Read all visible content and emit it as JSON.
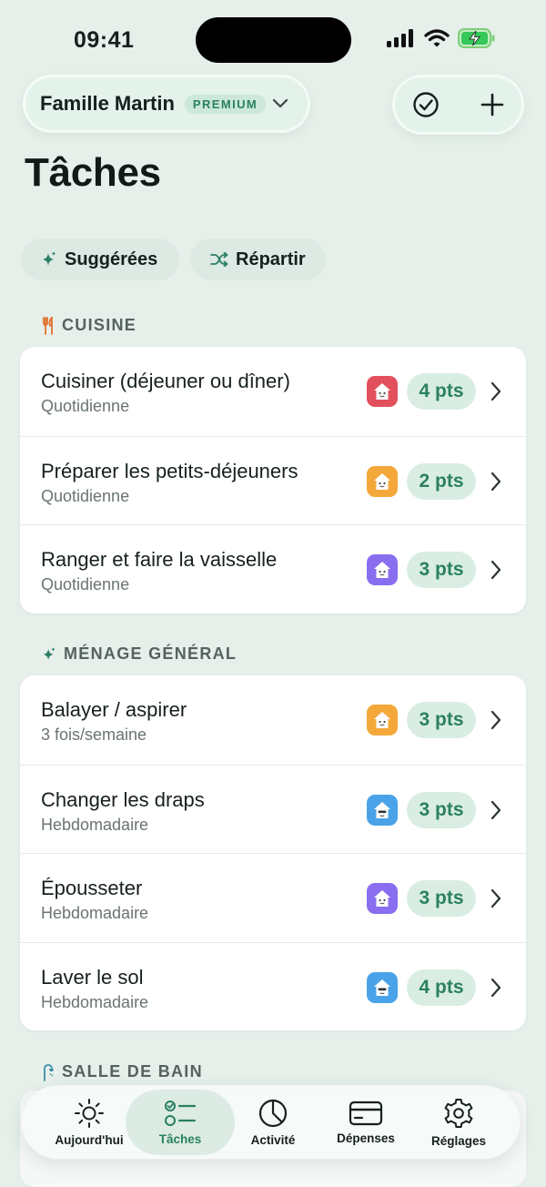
{
  "status": {
    "time": "09:41"
  },
  "header": {
    "household": "Famille Martin",
    "badge": "PREMIUM",
    "title": "Tâches"
  },
  "chips": [
    {
      "label": "Suggérées",
      "icon": "sparkle-icon"
    },
    {
      "label": "Répartir",
      "icon": "shuffle-icon"
    }
  ],
  "sections": [
    {
      "title": "CUISINE",
      "icon": "fork-knife-icon",
      "tasks": [
        {
          "name": "Cuisiner (déjeuner ou dîner)",
          "frequency": "Quotidienne",
          "points": "4 pts",
          "avatar_color": "#e2505e"
        },
        {
          "name": "Préparer les petits-déjeuners",
          "frequency": "Quotidienne",
          "points": "2 pts",
          "avatar_color": "#f4a83a"
        },
        {
          "name": "Ranger et faire la vaisselle",
          "frequency": "Quotidienne",
          "points": "3 pts",
          "avatar_color": "#8a6ef0"
        }
      ]
    },
    {
      "title": "MÉNAGE GÉNÉRAL",
      "icon": "sparkle-icon",
      "tasks": [
        {
          "name": "Balayer / aspirer",
          "frequency": "3 fois/semaine",
          "points": "3 pts",
          "avatar_color": "#f4a83a"
        },
        {
          "name": "Changer les draps",
          "frequency": "Hebdomadaire",
          "points": "3 pts",
          "avatar_color": "#4aa3e8"
        },
        {
          "name": "Épousseter",
          "frequency": "Hebdomadaire",
          "points": "3 pts",
          "avatar_color": "#8a6ef0"
        },
        {
          "name": "Laver le sol",
          "frequency": "Hebdomadaire",
          "points": "4 pts",
          "avatar_color": "#4aa3e8"
        }
      ]
    },
    {
      "title": "SALLE DE BAIN",
      "icon": "shower-icon",
      "tasks": []
    }
  ],
  "tabs": [
    {
      "label": "Aujourd'hui",
      "icon": "sun-icon",
      "active": false
    },
    {
      "label": "Tâches",
      "icon": "checklist-icon",
      "active": true
    },
    {
      "label": "Activité",
      "icon": "pie-chart-icon",
      "active": false
    },
    {
      "label": "Dépenses",
      "icon": "credit-card-icon",
      "active": false
    },
    {
      "label": "Réglages",
      "icon": "gear-icon",
      "active": false
    }
  ],
  "colors": {
    "accent": "#2b8062",
    "background": "#e6efea",
    "section_cuisine_icon": "#e2702e",
    "section_menage_icon": "#2b8062",
    "section_sdb_icon": "#3a8fa8"
  }
}
